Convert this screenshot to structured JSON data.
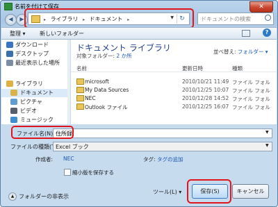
{
  "window": {
    "title": "名前を付けて保存",
    "close_glyph": "✕"
  },
  "nav": {
    "back_glyph": "◀",
    "forward_glyph": "▶"
  },
  "address": {
    "crumbs": [
      "ライブラリ",
      "ドキュメント"
    ],
    "separator": "▸",
    "dropdown_glyph": "▼",
    "refresh_glyph": "↻"
  },
  "search": {
    "placeholder": "ドキュメントの検索"
  },
  "toolbar": {
    "organize": "整理 ▾",
    "new_folder": "新しいフォルダー",
    "help": "?"
  },
  "sidebar": {
    "items": [
      {
        "label": "ダウンロード",
        "icon": "download-folder-icon",
        "color": "#3b74c7"
      },
      {
        "label": "デスクトップ",
        "icon": "desktop-icon",
        "color": "#3a6fb0"
      },
      {
        "label": "最近表示した場所",
        "icon": "recent-places-icon",
        "color": "#7b8ea6"
      },
      {
        "label": "ライブラリ",
        "icon": "library-icon",
        "color": "#e0b040"
      },
      {
        "label": "ドキュメント",
        "icon": "documents-icon",
        "color": "#d9b24a"
      },
      {
        "label": "ピクチャ",
        "icon": "pictures-icon",
        "color": "#5f9dd4"
      },
      {
        "label": "ビデオ",
        "icon": "videos-icon",
        "color": "#555f6d"
      },
      {
        "label": "ミュージック",
        "icon": "music-icon",
        "color": "#3c8fd0"
      }
    ]
  },
  "main": {
    "library_title": "ドキュメント ライブラリ",
    "target_label": "対象フォルダー: ",
    "target_value": "2 か所",
    "sort_label": "並べ替え: ",
    "sort_value": "フォルダー ▾",
    "columns": {
      "name": "名前",
      "date": "更新日時",
      "type": "種類"
    },
    "files": [
      {
        "name": "microsoft",
        "date": "2010/10/21 11:49",
        "type": "ファイル フォル"
      },
      {
        "name": "My Data Sources",
        "date": "2010/12/25 10:07",
        "type": "ファイル フォル"
      },
      {
        "name": "NEC",
        "date": "2010/12/28 14:52",
        "type": "ファイル フォル"
      },
      {
        "name": "Outlook ファイル",
        "date": "2010/12/25 16:07",
        "type": "ファイル フォル"
      }
    ]
  },
  "form": {
    "filename_label": "ファイル名(N):",
    "filename_value": "住所録",
    "filetype_label": "ファイルの種類(T):",
    "filetype_value": "Excel ブック",
    "author_label": "作成者:",
    "author_value": "NEC",
    "tag_label": "タグ:",
    "tag_value": "タグの追加",
    "thumbnail_label": "縮小版を保存する",
    "dropdown_glyph": "▼"
  },
  "footer": {
    "hide_folders": "フォルダーの非表示",
    "tools": "ツール(L) ▾",
    "save": "保存(S)",
    "cancel": "キャンセル"
  },
  "colors": {
    "highlight": "#e0151b",
    "link": "#1a55b3",
    "title_text": "#1e3f8a"
  }
}
